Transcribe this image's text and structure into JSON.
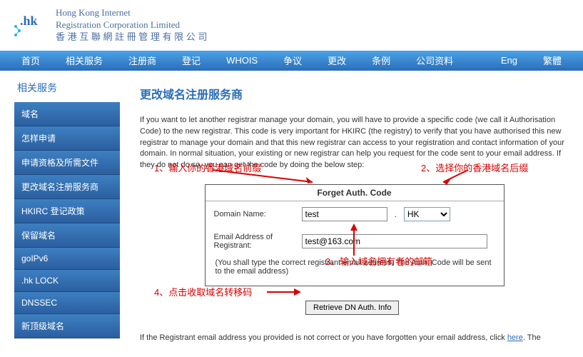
{
  "logo": {
    "suffix": ".hk",
    "en1": "Hong Kong Internet",
    "en2": "Registration Corporation Limited",
    "zh": "香 港 互 聯 網 註 冊 管 理 有 限 公 司"
  },
  "nav": {
    "items": [
      "首页",
      "相关服务",
      "注册商",
      "登记",
      "WHOIS",
      "争议",
      "更改",
      "条例",
      "公司资料"
    ],
    "lang_eng": "Eng",
    "lang_trad": "繁體"
  },
  "section_title": "相关服务",
  "sidebar": {
    "items": [
      "域名",
      "怎样申请",
      "申请资格及所需文件",
      "更改域名注册服务商",
      "HKIRC 登记政策",
      "保留域名",
      "goIPv6",
      ".hk LOCK",
      "DNSSEC",
      "新顶级域名"
    ]
  },
  "main": {
    "title": "更改域名注册服务商",
    "intro": "If you want to let another registrar manage your domain, you will have to provide a specific code (we call it Authorisation Code) to the new registrar. This code is very important for HKIRC (the registry) to verify that you have authorised this new registrar to manage your domain and that this new registrar can access to your registration and contact information of your domain. In normal situation, your existing or new registrar can help you request for the code sent to your email address. If they do not do so, you can get the code by doing the below step:",
    "form": {
      "box_title": "Forget Auth. Code",
      "label_domain": "Domain Name:",
      "domain_value": "test",
      "dot": ".",
      "suffix_value": "HK",
      "label_email": "Email Address of Registrant:",
      "email_value": "test@163.com",
      "note": "(You shall type the correct registrant email address. The Auth. Code will be sent to the email address)"
    },
    "button": "Retrieve DN Auth. Info",
    "footnote_pre": "If the Registrant email address you provided is not correct or you have forgotten your email address, click ",
    "footnote_link": "here",
    "footnote_post": ". The"
  },
  "annotations": {
    "a1": "1、输入你的香港域名前缀",
    "a2": "2、选择你的香港域名后缀",
    "a3": "3、输入域名拥有者的邮箱",
    "a4": "4、点击收取域名转移码"
  }
}
